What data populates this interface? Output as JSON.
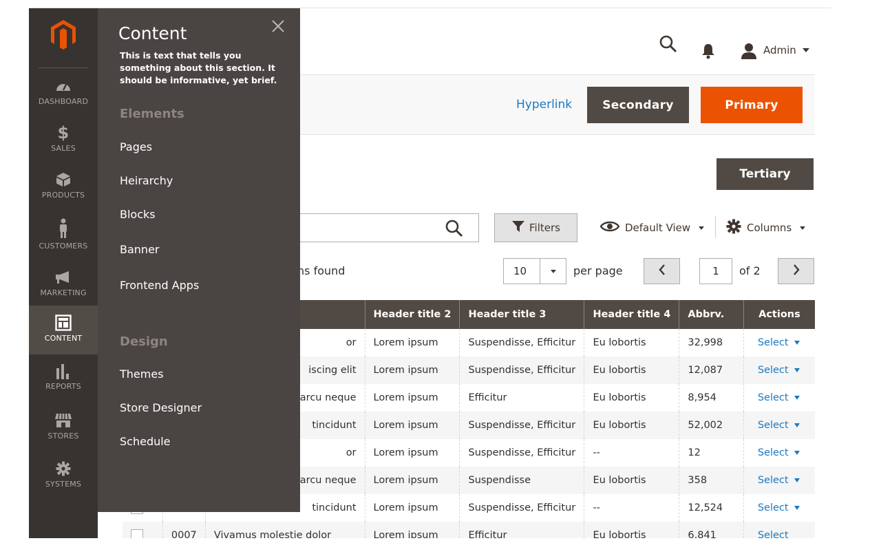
{
  "header": {
    "user_name": "Admin"
  },
  "action_bar": {
    "hyperlink": "Hyperlink",
    "secondary": "Secondary",
    "primary": "Primary",
    "tertiary": "Tertiary"
  },
  "toolbar": {
    "filters": "Filters",
    "default_view": "Default View",
    "columns": "Columns"
  },
  "pager": {
    "records_text": "ns found",
    "per_page_value": "10",
    "per_page_label": "per page",
    "current_page": "1",
    "of_text": "of 2"
  },
  "grid": {
    "headers": [
      "",
      "",
      "",
      "Header title 2",
      "Header title 3",
      "Header title 4",
      "Abbrv.",
      "Actions"
    ],
    "rows": [
      {
        "id": "",
        "title": "or",
        "h2": "Lorem ipsum",
        "h3": "Suspendisse, Efficitur",
        "h4": "Eu lobortis",
        "abbrv": "32,998",
        "action": "Select"
      },
      {
        "id": "",
        "title": "iscing elit",
        "h2": "Lorem ipsum",
        "h3": "Suspendisse, Efficitur",
        "h4": "Eu lobortis",
        "abbrv": "12,087",
        "action": "Select"
      },
      {
        "id": "",
        "title": "arcu neque",
        "h2": "Lorem ipsum",
        "h3": "Efficitur",
        "h4": "Eu lobortis",
        "abbrv": "8,954",
        "action": "Select"
      },
      {
        "id": "",
        "title": "tincidunt",
        "h2": "Lorem ipsum",
        "h3": "Suspendisse, Efficitur",
        "h4": "Eu lobortis",
        "abbrv": "52,002",
        "action": "Select"
      },
      {
        "id": "",
        "title": "or",
        "h2": "Lorem ipsum",
        "h3": "Suspendisse, Efficitur",
        "h4": "--",
        "abbrv": "12",
        "action": "Select"
      },
      {
        "id": "",
        "title": "arcu neque",
        "h2": "Lorem ipsum",
        "h3": "Suspendisse",
        "h4": "Eu lobortis",
        "abbrv": "358",
        "action": "Select"
      },
      {
        "id": "",
        "title": "tincidunt",
        "h2": "Lorem ipsum",
        "h3": "Suspendisse, Efficitur",
        "h4": "--",
        "abbrv": "12,524",
        "action": "Select"
      },
      {
        "id": "0007",
        "title": "Vivamus molestie dolor",
        "h2": "Lorem ipsum",
        "h3": "Efficitur",
        "h4": "Eu lobortis",
        "abbrv": "6,841",
        "action": "Select"
      }
    ]
  },
  "nav": {
    "items": [
      {
        "label": "DASHBOARD",
        "icon": "dashboard-icon"
      },
      {
        "label": "SALES",
        "icon": "dollar-icon"
      },
      {
        "label": "PRODUCTS",
        "icon": "box-icon"
      },
      {
        "label": "CUSTOMERS",
        "icon": "person-icon"
      },
      {
        "label": "MARKETING",
        "icon": "megaphone-icon"
      },
      {
        "label": "CONTENT",
        "icon": "layout-icon"
      },
      {
        "label": "REPORTS",
        "icon": "bar-chart-icon"
      },
      {
        "label": "STORES",
        "icon": "storefront-icon"
      },
      {
        "label": "SYSTEMS",
        "icon": "gear-icon"
      }
    ]
  },
  "flyout": {
    "title": "Content",
    "description": "This is text that tells you something about this section.  It should be informative, yet brief.",
    "group1": "Elements",
    "group1_links": [
      "Pages",
      "Heirarchy",
      "Blocks",
      "Banner",
      "Frontend Apps"
    ],
    "group2": "Design",
    "group2_links": [
      "Themes",
      "Store Designer",
      "Schedule"
    ]
  },
  "colors": {
    "nav_bg": "#373330",
    "flyout_bg": "#4a4542",
    "primary": "#eb5202",
    "secondary": "#514943",
    "link": "#1979c3"
  }
}
